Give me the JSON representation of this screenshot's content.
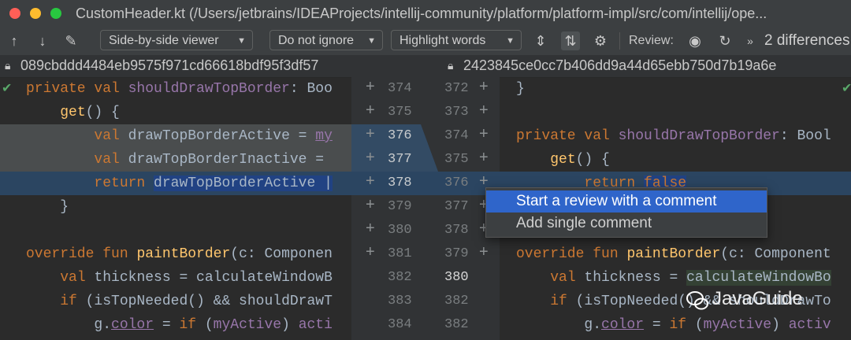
{
  "window": {
    "title": "CustomHeader.kt (/Users/jetbrains/IDEAProjects/intellij-community/platform/platform-impl/src/com/intellij/ope..."
  },
  "toolbar": {
    "viewer_mode": "Side-by-side viewer",
    "whitespace_mode": "Do not ignore",
    "highlight_mode": "Highlight words",
    "review_label": "Review:",
    "more_label": "»",
    "differences": "2 differences"
  },
  "revisions": {
    "left_hash": "089cbddd4484eb9575f971cd66618bdf95f3df57",
    "right_hash": "2423845ce0cc7b406dd9a44d65ebb750d7b19a6e"
  },
  "gutter": {
    "left_numbers": [
      "374",
      "375",
      "376",
      "377",
      "378",
      "379",
      "380",
      "381",
      "382",
      "383",
      "384"
    ],
    "right_numbers": [
      "372",
      "373",
      "374",
      "375",
      "376",
      "377",
      "378",
      "379",
      "380",
      "382",
      "382"
    ]
  },
  "left_code": [
    "private val shouldDrawTopBorder: Boo",
    "    get() {",
    "        val drawTopBorderActive = my",
    "        val drawTopBorderInactive =",
    "        return drawTopBorderActive |",
    "    }",
    "",
    "override fun paintBorder(c: Componen",
    "    val thickness = calculateWindowB",
    "    if (isTopNeeded() && shouldDrawT",
    "        g.color = if (myActive) acti"
  ],
  "right_code": [
    "}",
    "",
    "private val shouldDrawTopBorder: Bool",
    "    get() {",
    "        return false",
    "",
    "",
    "override fun paintBorder(c: Component",
    "    val thickness = calculateWindowBo",
    "    if (isTopNeeded() && shouldDrawTo",
    "        g.color = if (myActive) activ"
  ],
  "context_menu": {
    "items": [
      "Start a review with a comment",
      "Add single comment"
    ]
  },
  "watermark": {
    "text": "JavaGuide"
  }
}
